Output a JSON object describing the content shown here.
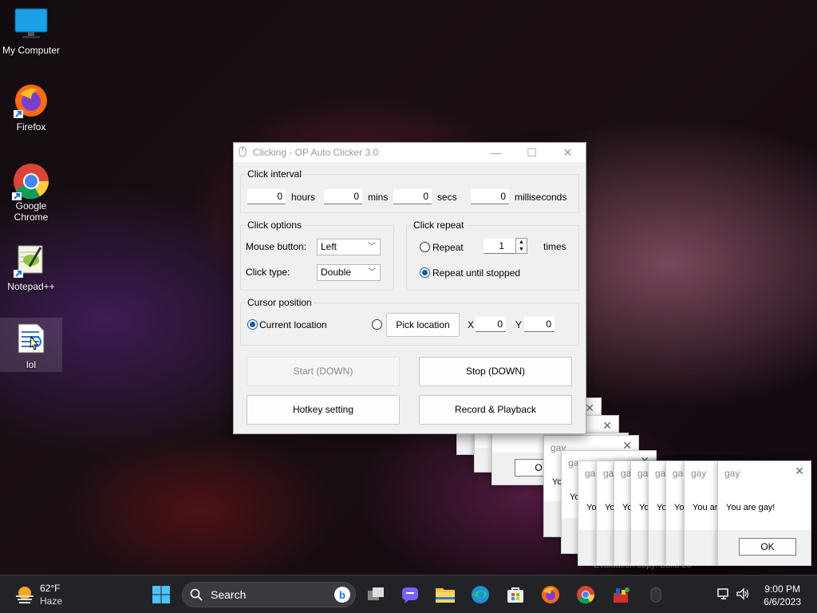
{
  "desktop": {
    "icons": [
      {
        "label": "My Computer"
      },
      {
        "label": "Firefox"
      },
      {
        "label": "Google Chrome"
      },
      {
        "label": "Notepad++"
      },
      {
        "label": "lol"
      }
    ]
  },
  "autoclicker": {
    "title": "Clicking - OP Auto Clicker 3.0",
    "interval": {
      "legend": "Click interval",
      "hours": "0",
      "hours_label": "hours",
      "mins": "0",
      "mins_label": "mins",
      "secs": "0",
      "secs_label": "secs",
      "ms": "0",
      "ms_label": "milliseconds"
    },
    "options": {
      "legend": "Click options",
      "mouse_button_label": "Mouse button:",
      "mouse_button_value": "Left",
      "click_type_label": "Click type:",
      "click_type_value": "Double"
    },
    "repeat": {
      "legend": "Click repeat",
      "repeat_label": "Repeat",
      "repeat_count": "1",
      "times_label": "times",
      "until_stopped_label": "Repeat until stopped",
      "selected": "until_stopped"
    },
    "cursor": {
      "legend": "Cursor position",
      "current_label": "Current location",
      "pick_label": "Pick location",
      "x_label": "X",
      "x_value": "0",
      "y_label": "Y",
      "y_value": "0",
      "selected": "current"
    },
    "buttons": {
      "start": "Start (DOWN)",
      "stop": "Stop (DOWN)",
      "hotkey": "Hotkey setting",
      "record": "Record & Playback"
    }
  },
  "message_boxes": {
    "title": "gay",
    "text": "You are gay!",
    "ok": "OK",
    "partial_text_1": "You ar",
    "partial_text_2": "Yo",
    "partial_text_3": "ga",
    "partial_ok": "O"
  },
  "watermark": "Evaluation copy. Build 25",
  "taskbar": {
    "weather_temp": "62°F",
    "weather_desc": "Haze",
    "search_placeholder": "Search",
    "time": "9:00 PM",
    "date": "6/6/2023"
  },
  "colors": {
    "accent": "#0b5cad",
    "taskbar_bg": "#222326"
  }
}
